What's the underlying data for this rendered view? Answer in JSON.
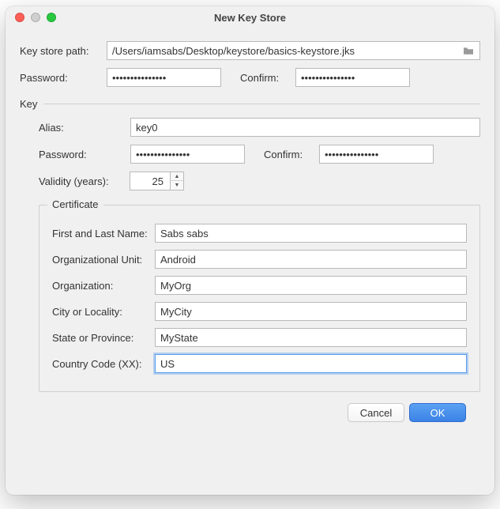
{
  "window": {
    "title": "New Key Store"
  },
  "path": {
    "label": "Key store path:",
    "value": "/Users/iamsabs/Desktop/keystore/basics-keystore.jks"
  },
  "password": {
    "label": "Password:",
    "value": "•••••••••••••••",
    "confirm_label": "Confirm:",
    "confirm_value": "•••••••••••••••"
  },
  "key": {
    "section_label": "Key",
    "alias_label": "Alias:",
    "alias_value": "key0",
    "password_label": "Password:",
    "password_value": "•••••••••••••••",
    "confirm_label": "Confirm:",
    "confirm_value": "•••••••••••••••",
    "validity_label": "Validity (years):",
    "validity_value": "25"
  },
  "certificate": {
    "section_label": "Certificate",
    "first_last_label": "First and Last Name:",
    "first_last_value": "Sabs sabs",
    "org_unit_label": "Organizational Unit:",
    "org_unit_value": "Android",
    "org_label": "Organization:",
    "org_value": "MyOrg",
    "city_label": "City or Locality:",
    "city_value": "MyCity",
    "state_label": "State or Province:",
    "state_value": "MyState",
    "country_label": "Country Code (XX):",
    "country_value": "US"
  },
  "buttons": {
    "cancel": "Cancel",
    "ok": "OK"
  }
}
